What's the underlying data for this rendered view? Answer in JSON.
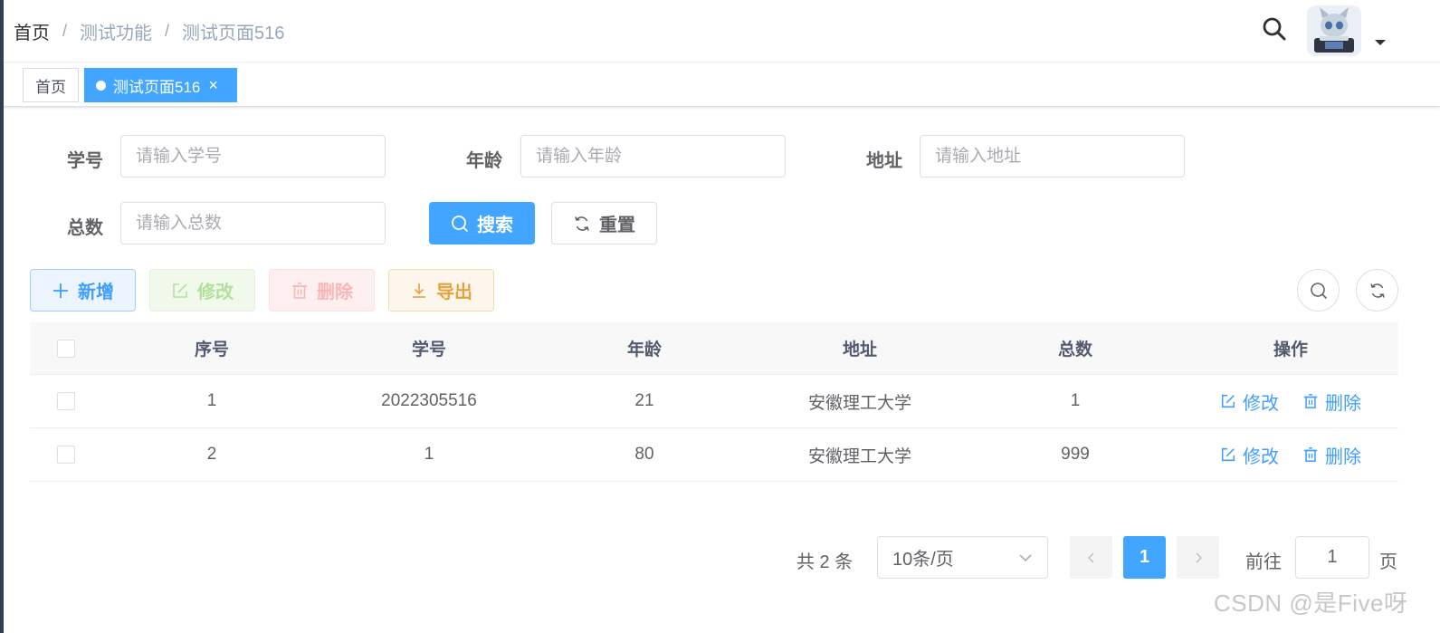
{
  "breadcrumb": {
    "items": [
      "首页",
      "测试功能",
      "测试页面516"
    ],
    "separator": "/"
  },
  "navbar": {
    "search_icon": "search-icon",
    "avatar": "user-avatar",
    "dropdown_icon": "caret-down-icon"
  },
  "tags": {
    "home": "首页",
    "active": "测试页面516",
    "close_glyph": "×"
  },
  "form": {
    "student_id": {
      "label": "学号",
      "placeholder": "请输入学号"
    },
    "age": {
      "label": "年龄",
      "placeholder": "请输入年龄"
    },
    "address": {
      "label": "地址",
      "placeholder": "请输入地址"
    },
    "total": {
      "label": "总数",
      "placeholder": "请输入总数"
    },
    "search_label": "搜索",
    "reset_label": "重置"
  },
  "toolbar": {
    "add_label": "新增",
    "edit_label": "修改",
    "delete_label": "删除",
    "export_label": "导出"
  },
  "table": {
    "columns": [
      "序号",
      "学号",
      "年龄",
      "地址",
      "总数",
      "操作"
    ],
    "rows": [
      {
        "index": "1",
        "student_id": "2022305516",
        "age": "21",
        "address": "安徽理工大学",
        "total": "1",
        "edit": "修改",
        "delete": "删除"
      },
      {
        "index": "2",
        "student_id": "1",
        "age": "80",
        "address": "安徽理工大学",
        "total": "999",
        "edit": "修改",
        "delete": "删除"
      }
    ]
  },
  "pagination": {
    "total_text": "共 2 条",
    "page_size": "10条/页",
    "current_page": "1",
    "goto_label": "前往",
    "goto_value": "1",
    "page_suffix": "页"
  },
  "watermark": "CSDN @是Five呀",
  "colors": {
    "primary": "#42a5ff",
    "success_light": "#b3e19d",
    "danger_light": "#fab6b6",
    "warning": "#e6a23c"
  }
}
